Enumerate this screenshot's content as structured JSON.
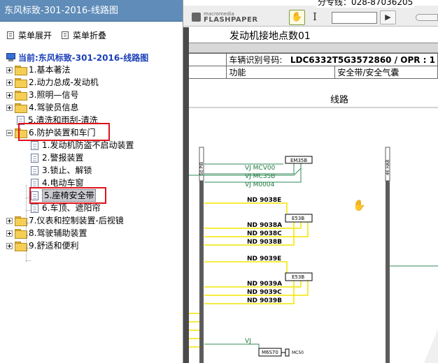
{
  "left_panel": {
    "title": "东风标致-301-2016-线路图",
    "expand_label": "菜单展开",
    "collapse_label": "菜单折叠",
    "root_label": "当前:东风标致-301-2016-线路图",
    "items": [
      {
        "label": "1.基本著法",
        "type": "folder",
        "toggle": "plus"
      },
      {
        "label": "2.动力总成-发动机",
        "type": "folder",
        "toggle": "plus"
      },
      {
        "label": "3.照明—信号",
        "type": "folder",
        "toggle": "plus"
      },
      {
        "label": "4.驾驶员信息",
        "type": "folder",
        "toggle": "plus"
      },
      {
        "label": "5.清洗和雨刮-清洗",
        "type": "doc",
        "toggle": "none"
      },
      {
        "label": "6.防护装置和车门",
        "type": "folder",
        "toggle": "minus"
      },
      {
        "label": "7.仪表和控制装置-后视镜",
        "type": "folder",
        "toggle": "plus"
      },
      {
        "label": "8.驾驶辅助装置",
        "type": "folder",
        "toggle": "plus"
      },
      {
        "label": "9.舒适和便利",
        "type": "folder",
        "toggle": "plus"
      }
    ],
    "sub_items": [
      {
        "label": "1.发动机防盗不启动装置"
      },
      {
        "label": "2.警报装置"
      },
      {
        "label": "3.锁止、解锁"
      },
      {
        "label": "4.电动车窗"
      },
      {
        "label": "5.座椅安全带",
        "selected": true
      },
      {
        "label": "6.车顶、遮阳帘"
      }
    ]
  },
  "viewer": {
    "banner": "分专线：028-87036205",
    "logo_small": "macromedia",
    "logo_big": "FLASHPAPER",
    "page_title": "发动机接地点数01",
    "vin_label": "车辆识别号码:",
    "vin_value": "LDC6332T5G3572860 / OPR : 1",
    "function_label": "功能",
    "function_value": "安全带/安全气囊",
    "section": "线路",
    "diagram": {
      "bar_left_label": "50 PIB",
      "bar_right_label": "46 HAB",
      "labels": [
        {
          "text": "VJ MCV00",
          "color": "#1f7a3f"
        },
        {
          "text": "VJ MC35B",
          "color": "#1f7a3f"
        },
        {
          "text": "VJ M0004",
          "color": "#1f7a3f"
        },
        {
          "text": "ND 9038E",
          "color": "#000000"
        },
        {
          "text": "ND 9038A",
          "color": "#000000"
        },
        {
          "text": "ND 9038C",
          "color": "#000000"
        },
        {
          "text": "ND 9038B",
          "color": "#000000"
        },
        {
          "text": "ND 9039E",
          "color": "#000000"
        },
        {
          "text": "ND 9039A",
          "color": "#000000"
        },
        {
          "text": "ND 9039C",
          "color": "#000000"
        },
        {
          "text": "ND 9039B",
          "color": "#000000"
        },
        {
          "text": "VJ",
          "color": "#1f7a3f"
        }
      ],
      "boxes": [
        "EM35B",
        "E53B",
        "E53B",
        "M6S70"
      ],
      "tag_mc50": "MC50"
    }
  },
  "colors": {
    "title_bar": "#5f8cb8",
    "highlight_red": "#e0121a",
    "wire_yellow": "#f2e600",
    "wire_green": "#2f8a5a",
    "root_blue": "#1a3fb8"
  }
}
